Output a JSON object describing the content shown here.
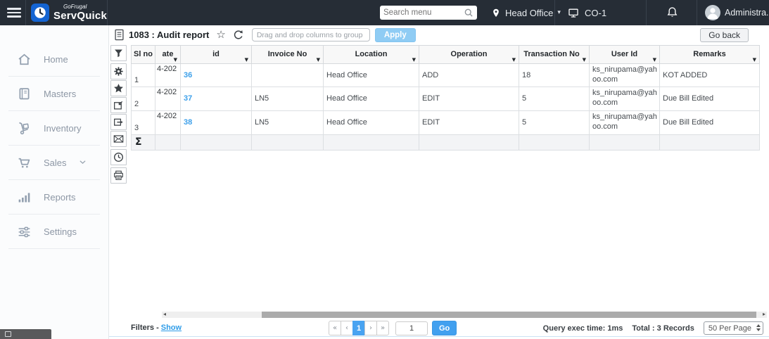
{
  "topbar": {
    "brand_top": "GoFrugal",
    "brand_bottom": "ServQuick",
    "search_placeholder": "Search menu",
    "location_label": "Head Office",
    "terminal_label": "CO-1",
    "user_label": "Administra..."
  },
  "sidebar": {
    "items": [
      {
        "label": "Home"
      },
      {
        "label": "Masters"
      },
      {
        "label": "Inventory"
      },
      {
        "label": "Sales"
      },
      {
        "label": "Reports"
      },
      {
        "label": "Settings"
      }
    ]
  },
  "toolbar": {
    "title": "1083 : Audit report",
    "group_placeholder": "Drag and drop columns to group",
    "apply_label": "Apply",
    "go_back_label": "Go back"
  },
  "table": {
    "columns": [
      "Sl no",
      "ate",
      "id",
      "Invoice No",
      "Location",
      "Operation",
      "Transaction No",
      "User Id",
      "Remarks"
    ],
    "rows": [
      {
        "sl_no": "1",
        "date": "4-202",
        "id": "36",
        "invoice_no": "",
        "location": "Head Office",
        "operation": "ADD",
        "transaction_no": "18",
        "user_id": "ks_nirupama@yahoo.com",
        "remarks": "KOT ADDED"
      },
      {
        "sl_no": "2",
        "date": "4-202",
        "id": "37",
        "invoice_no": "LN5",
        "location": "Head Office",
        "operation": "EDIT",
        "transaction_no": "5",
        "user_id": "ks_nirupama@yahoo.com",
        "remarks": "Due Bill Edited"
      },
      {
        "sl_no": "3",
        "date": "4-202",
        "id": "38",
        "invoice_no": "LN5",
        "location": "Head Office",
        "operation": "EDIT",
        "transaction_no": "5",
        "user_id": "ks_nirupama@yahoo.com",
        "remarks": "Due Bill Edited"
      }
    ],
    "summary_symbol": "Σ"
  },
  "footer": {
    "filters_label": "Filters -",
    "show_link": "Show",
    "pagination": {
      "first": "«",
      "prev": "‹",
      "current": "1",
      "next": "›",
      "last": "»",
      "page_input": "1",
      "go_label": "Go"
    },
    "query_exec_time": "Query exec time: 1ms",
    "total_records": "Total : 3 Records",
    "per_page": "50 Per Page"
  },
  "icons": {
    "sort_arrow": "▼",
    "chevron_down": "▾",
    "star_outline": "☆",
    "scroll_left": "◂",
    "scroll_right": "▸"
  },
  "colors": {
    "topbar_bg": "#262d36",
    "accent_blue": "#42a0ef",
    "apply_blue": "#8fccf4",
    "link_blue": "#2e9ce8"
  }
}
